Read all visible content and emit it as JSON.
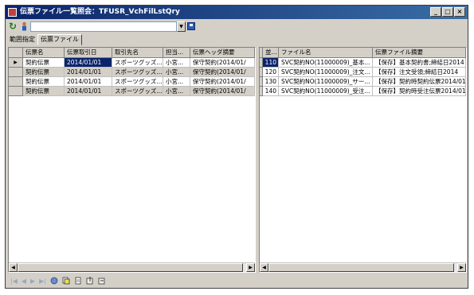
{
  "window": {
    "title": "伝票ファイル一覧照会：TFUSR_VchFilLstQry"
  },
  "title_buttons": [
    "_",
    "□",
    "×"
  ],
  "tabs": [
    {
      "label": "範囲指定"
    },
    {
      "label": "伝票ファイル"
    }
  ],
  "left_grid": {
    "columns": [
      "伝票名",
      "伝票取引日",
      "取引先名",
      "担当...",
      "伝票ヘッダ摘要"
    ],
    "rows": [
      [
        "契約伝票",
        "2014/01/01",
        "スポーツグッズ...",
        "小宮...",
        "保守契約(2014/01/"
      ],
      [
        "契約伝票",
        "2014/01/01",
        "スポーツグッズ...",
        "小宮...",
        "保守契約(2014/01/"
      ],
      [
        "契約伝票",
        "2014/01/01",
        "スポーツグッズ...",
        "小宮...",
        "保守契約(2014/01/"
      ],
      [
        "契約伝票",
        "2014/01/01",
        "スポーツグッズ...",
        "小宮...",
        "保守契約(2014/01/"
      ]
    ]
  },
  "right_grid": {
    "columns": [
      "並...",
      "ファイル名",
      "伝票ファイル摘要"
    ],
    "rows": [
      [
        "110",
        "SVC契約NO(11000009)_基本...",
        "【保存】基本契約書;締結日2014"
      ],
      [
        "120",
        "SVC契約NO(11000009)_注文...",
        "【保存】注文受領;締結日2014"
      ],
      [
        "130",
        "SVC契約NO(11000009)_サー...",
        "【保存】契約時契約伝票2014/01"
      ],
      [
        "140",
        "SVC契約NO(11000009)_受注...",
        "【保存】契約時受注伝票2014/01"
      ]
    ]
  }
}
